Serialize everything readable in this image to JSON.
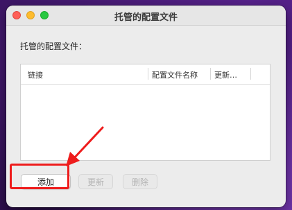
{
  "window": {
    "title": "托管的配置文件"
  },
  "content": {
    "section_label": "托管的配置文件："
  },
  "table": {
    "columns": [
      "链接",
      "配置文件名称",
      "更新…"
    ]
  },
  "buttons": {
    "add": "添加",
    "update": "更新",
    "delete": "删除"
  },
  "annotation": {
    "color": "#ee1c1c"
  }
}
